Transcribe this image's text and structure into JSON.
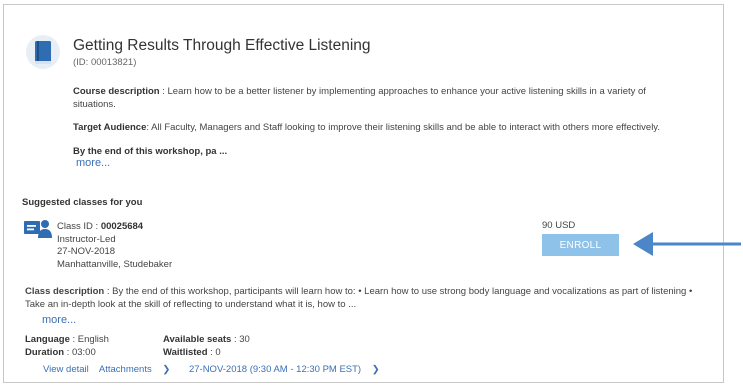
{
  "course": {
    "title": "Getting Results Through Effective Listening",
    "id_text": "(ID: 00013821)",
    "description_label": "Course description",
    "description": " : Learn how to be a better listener by implementing approaches to enhance your active listening skills in a variety of situations.",
    "audience_label": "Target Audience",
    "audience": ": All Faculty, Managers and Staff looking to improve their listening skills and be able to interact with others more effectively.",
    "outcome_text": "By the end of this workshop, pa ...",
    "more_label": "more..."
  },
  "suggested": {
    "section_title": "Suggested classes for you",
    "class_id_label": "Class ID : ",
    "class_id": "00025684",
    "delivery": "Instructor-Led",
    "date": "27-NOV-2018",
    "location": "Manhattanville, Studebaker",
    "price": "90 USD",
    "enroll_label": "ENROLL",
    "class_desc_label": "Class description",
    "class_desc": " : By the end of this workshop, participants will learn how to: • Learn how to use strong body language and vocalizations as part of listening • Take an in-depth look at the skill of reflecting to understand what it is, how to ...",
    "more_label": "more...",
    "language_label": "Language",
    "language": " : English",
    "duration_label": "Duration",
    "duration": " : 03:00",
    "seats_label": "Available seats",
    "seats": " : 30",
    "waitlisted_label": "Waitlisted",
    "waitlisted": " : 0",
    "view_detail_label": "View detail",
    "attachments_label": "Attachments",
    "session_label": "27-NOV-2018 (9:30 AM - 12:30 PM EST)"
  },
  "colors": {
    "link": "#3b6fb6",
    "enroll_button": "#8fc2e9",
    "icon_blue": "#2f6db3",
    "arrow": "#4a86c8"
  }
}
